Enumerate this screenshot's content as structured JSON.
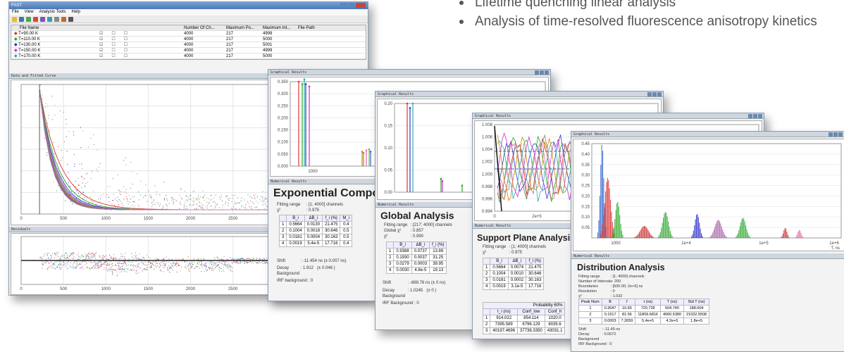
{
  "bullets": [
    "Lifetime quenching linear analysis",
    "Analysis of time-resolved fluorescence anisotropy kinetics"
  ],
  "app": {
    "title": "FAST",
    "menu": [
      "File",
      "View",
      "Analysis Tools",
      "Help"
    ],
    "columns": [
      "File Name",
      "Number Of Ch...",
      "Maximum Po...",
      "Maximum Int...",
      "File Path"
    ],
    "files": [
      {
        "name": "T=90.00 K",
        "ch": "4000",
        "pos": "217",
        "int": "4999",
        "color": "#d33"
      },
      {
        "name": "T=110.00 K",
        "ch": "4000",
        "pos": "217",
        "int": "5000",
        "color": "#2a2"
      },
      {
        "name": "T=130.00 K",
        "ch": "4000",
        "pos": "217",
        "int": "5001",
        "color": "#33c"
      },
      {
        "name": "T=150.00 K",
        "ch": "4000",
        "pos": "217",
        "int": "4999",
        "color": "#c3c"
      },
      {
        "name": "T=170.00 K",
        "ch": "4000",
        "pos": "217",
        "int": "5000",
        "color": "#3aa"
      }
    ],
    "fitted_title": "Data and Fitted Curve",
    "residuals_title": "Residuals",
    "x_ticks": [
      "0",
      "500",
      "1000",
      "1500",
      "2000",
      "2500",
      "3000",
      "3500",
      "4000"
    ],
    "x_unit": "Channel"
  },
  "exp": {
    "header": "Graphical Results",
    "num_header": "Numerical Results",
    "title": "Exponential Components",
    "fitting_label": "Fitting range",
    "fitting_val": ": [1; 4000] channels",
    "chi_label": "χ²",
    "chi_val": ": 0.975",
    "cols": [
      "",
      "B_i",
      "ΔB_i",
      "f_i (%)",
      "M_i"
    ],
    "rows": [
      [
        "1",
        "0.5664",
        "0.0130",
        "21.475",
        "0.4"
      ],
      [
        "2",
        "0.1004",
        "0.0018",
        "30.646",
        "0.5"
      ],
      [
        "3",
        "0.0181",
        "0.0004",
        "30.163",
        "0.5"
      ],
      [
        "4",
        "0.0019",
        "5.4e-5",
        "17.716",
        "0.4"
      ]
    ],
    "shift_label": "Shift",
    "shift_val": ": -11.454 ns (± 0.007 ns)",
    "decay_label": "Decay Background",
    "decay_val": ": 1.912",
    "decay_err": "(± 0.048 )",
    "irf_label": "IRF background",
    "irf_val": ": 0",
    "yt": [
      "0.350",
      "0.300",
      "0.250",
      "0.200",
      "0.150",
      "0.100",
      "0.050",
      "0.000"
    ],
    "xt": "1000"
  },
  "glob": {
    "header": "Graphical Results",
    "num_header": "Numerical Results",
    "title": "Global Analysis",
    "fitting_label": "Fitting range",
    "fitting_val": ": [217; 4000] channels",
    "chi_label": "Global χ²",
    "chi_val": ": 0.857",
    "chi2_label": "χ²",
    "chi2_val": ": 0.990",
    "cols": [
      "",
      "B_i",
      "ΔB_i",
      "f_i (%)"
    ],
    "rows": [
      [
        "1",
        "0.9388",
        "0.0737",
        "13.89"
      ],
      [
        "2",
        "0.1930",
        "0.0037",
        "31.25"
      ],
      [
        "3",
        "0.0279",
        "0.0003",
        "39.95"
      ],
      [
        "4",
        "0.0030",
        "4.8e-5",
        "19.13"
      ]
    ],
    "shift_label": "Shift",
    "shift_val": ": -869.76 ns (± 0 ns)",
    "decay_label": "Decay Background",
    "decay_val": ": 1.0245",
    "decay_err": "(± 0 )",
    "irf_label": "IRF Background",
    "irf_val": ": 0",
    "yt": [
      "0.20",
      "0.15",
      "0.10",
      "0.05",
      "0.00"
    ]
  },
  "supp": {
    "header": "Graphical Results",
    "num_header": "Numerical Results",
    "title": "Support Plane Analysis",
    "fitting_label": "Fitting range",
    "fitting_val": ": [1; 4000] channels",
    "chi_label": "χ²",
    "chi_val": ": 0.975",
    "cols": [
      "",
      "B_i",
      "ΔB_i",
      "f_i (%)"
    ],
    "rows": [
      [
        "1",
        "0.5664",
        "0.0074",
        "21.475"
      ],
      [
        "2",
        "0.1004",
        "0.0010",
        "30.646"
      ],
      [
        "3",
        "0.0181",
        "0.0002",
        "30.163"
      ],
      [
        "4",
        "0.0019",
        "3.1e-5",
        "17.716"
      ]
    ],
    "prob_label": "Probability 60%",
    "cols2": [
      "",
      "τ_i (ns)",
      "Conf_low",
      "Conf_h"
    ],
    "rows2": [
      [
        "1",
        "914.022",
        "854.114",
        "1020.0"
      ],
      [
        "2",
        "7395.589",
        "6796.129",
        "8035.6"
      ],
      [
        "3",
        "40197.4696",
        "37738.3350",
        "43031.1"
      ]
    ],
    "yt": [
      "1.008",
      "1.006",
      "1.004",
      "1.002",
      "1.000",
      "0.998",
      "0.996",
      "0.994"
    ],
    "xt": [
      "0",
      "2e+5",
      "4e+5",
      "6e+5"
    ]
  },
  "dist": {
    "header": "Graphical Results",
    "num_header": "Numerical Results",
    "title": "Distribution Analysis",
    "fitting_label": "Fitting range",
    "fitting_val": ": [1; 4000] channels",
    "intervals_label": "Number of Intervals",
    "intervals_val": ": 200",
    "bound_label": "Boundaries",
    "bound_val": ": [500.00; 2e+6] ns",
    "res_label": "Resolution",
    "res_val": ": 0",
    "chi_label": "χ²",
    "chi_val": ": 1.032",
    "cols": [
      "Peak Num",
      "B",
      "f",
      "τ (ns)",
      "T (ns)",
      "Std T (ns)"
    ],
    "rows": [
      [
        "1",
        "0.3047",
        "10.65",
        "720.728",
        "504.740",
        "188.004"
      ],
      [
        "2",
        "0.1517",
        "81.56",
        "11809.6816",
        "4060.5380",
        "21032.5508"
      ],
      [
        "3",
        "0.0003",
        "7.2659",
        "5.4e+5",
        "4.2e+5",
        "1.8e+5"
      ]
    ],
    "shift_label": "Shift",
    "shift_val": ": -11.45 ns",
    "decay_label": "Decay Background",
    "decay_val": ": 0.0672",
    "irf_label": "IRF Background",
    "irf_val": ": 0",
    "yt": [
      "0.45",
      "0.40",
      "0.35",
      "0.30",
      "0.25",
      "0.20",
      "0.15",
      "0.10",
      "0.05"
    ],
    "xt": [
      "1000",
      "1e+4",
      "1e+5",
      "1e+6"
    ],
    "x_unit": "T, ns"
  }
}
